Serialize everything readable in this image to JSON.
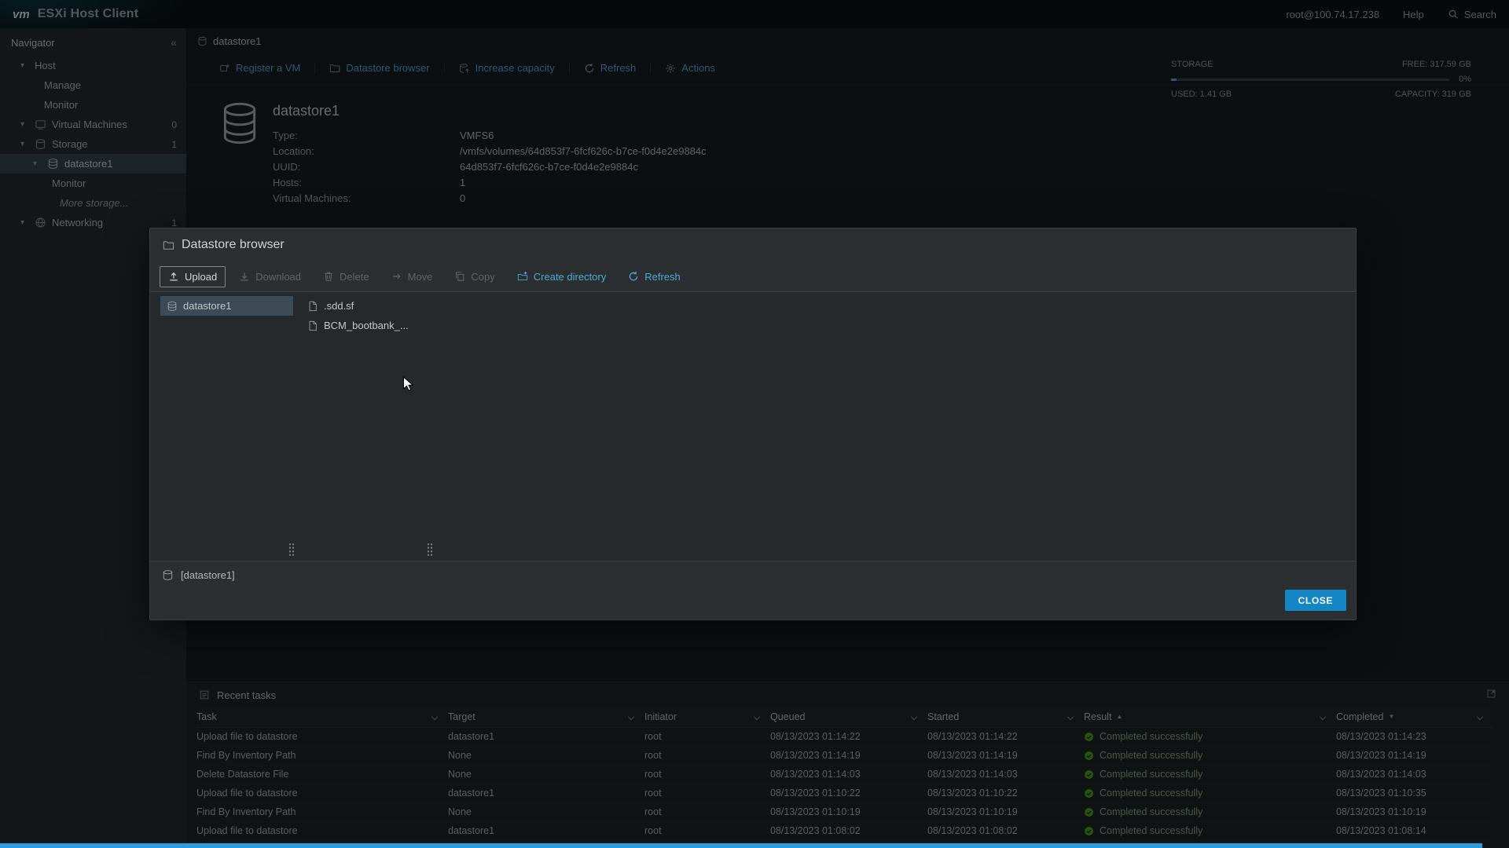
{
  "colors": {
    "accent": "#4fa8d5",
    "primary-button": "#1486c5",
    "success": "#52a114",
    "selection": "#3c4b55",
    "sidebar-selection": "#36444d"
  },
  "header": {
    "logo": "vm",
    "title": "ESXi Host Client",
    "user": "root@100.74.17.238",
    "help": "Help",
    "search": "Search"
  },
  "sidebar": {
    "title": "Navigator",
    "items": [
      {
        "label": "Host",
        "level": 0,
        "caret": true
      },
      {
        "label": "Manage",
        "level": 1,
        "plain": true
      },
      {
        "label": "Monitor",
        "level": 1,
        "plain": true
      },
      {
        "label": "Virtual Machines",
        "level": 0,
        "caret": true,
        "icon": "vm",
        "badge": "0"
      },
      {
        "label": "Storage",
        "level": 0,
        "caret": true,
        "icon": "storage",
        "badge": "1"
      },
      {
        "label": "datastore1",
        "level": 1,
        "caret": true,
        "icon": "datastore",
        "selected": true
      },
      {
        "label": "Monitor",
        "level": 2,
        "plain": true
      },
      {
        "label": "More storage...",
        "level": 3,
        "plain": true,
        "italic": true
      },
      {
        "label": "Networking",
        "level": 0,
        "caret": true,
        "icon": "network",
        "badge": "1"
      }
    ]
  },
  "main": {
    "tab": "datastore1",
    "toolbar": [
      {
        "label": "Register a VM",
        "icon": "register"
      },
      {
        "label": "Datastore browser",
        "icon": "browser"
      },
      {
        "label": "Increase capacity",
        "icon": "capacity"
      },
      {
        "label": "Refresh",
        "icon": "refresh"
      },
      {
        "label": "Actions",
        "icon": "gear"
      }
    ],
    "storage": {
      "label": "STORAGE",
      "free": "FREE: 317.59 GB",
      "percent": "0%",
      "used": "USED: 1.41 GB",
      "capacity": "CAPACITY: 319 GB"
    },
    "datastore_name": "datastore1",
    "info_rows": [
      {
        "label": "Type:",
        "value": "VMFS6"
      },
      {
        "label": "Location:",
        "value": "/vmfs/volumes/64d853f7-6fcf626c-b7ce-f0d4e2e9884c"
      },
      {
        "label": "UUID:",
        "value": "64d853f7-6fcf626c-b7ce-f0d4e2e9884c"
      },
      {
        "label": "Hosts:",
        "value": "1"
      },
      {
        "label": "Virtual Machines:",
        "value": "0"
      }
    ]
  },
  "modal": {
    "title": "Datastore browser",
    "toolbar": [
      {
        "label": "Upload",
        "icon": "upload",
        "state": "active"
      },
      {
        "label": "Download",
        "icon": "download",
        "state": "disabled"
      },
      {
        "label": "Delete",
        "icon": "delete",
        "state": "disabled"
      },
      {
        "label": "Move",
        "icon": "move",
        "state": "disabled"
      },
      {
        "label": "Copy",
        "icon": "copy",
        "state": "disabled"
      },
      {
        "label": "Create directory",
        "icon": "folder-plus",
        "state": "enabled"
      },
      {
        "label": "Refresh",
        "icon": "refresh",
        "state": "enabled"
      }
    ],
    "folders": [
      {
        "label": "datastore1",
        "selected": true
      }
    ],
    "files": [
      {
        "label": ".sdd.sf"
      },
      {
        "label": "BCM_bootbank_..."
      }
    ],
    "status": "[datastore1]",
    "close_label": "CLOSE"
  },
  "tasks": {
    "title": "Recent tasks",
    "columns": [
      {
        "label": "Task",
        "sort": ""
      },
      {
        "label": "Target",
        "sort": ""
      },
      {
        "label": "Initiator",
        "sort": ""
      },
      {
        "label": "Queued",
        "sort": ""
      },
      {
        "label": "Started",
        "sort": ""
      },
      {
        "label": "Result",
        "sort": "asc"
      },
      {
        "label": "Completed",
        "sort": "desc"
      }
    ],
    "rows": [
      {
        "task": "Upload file to datastore",
        "target": "datastore1",
        "initiator": "root",
        "queued": "08/13/2023 01:14:22",
        "started": "08/13/2023 01:14:22",
        "result": "Completed successfully",
        "completed": "08/13/2023 01:14:23"
      },
      {
        "task": "Find By Inventory Path",
        "target": "None",
        "initiator": "root",
        "queued": "08/13/2023 01:14:19",
        "started": "08/13/2023 01:14:19",
        "result": "Completed successfully",
        "completed": "08/13/2023 01:14:19"
      },
      {
        "task": "Delete Datastore File",
        "target": "None",
        "initiator": "root",
        "queued": "08/13/2023 01:14:03",
        "started": "08/13/2023 01:14:03",
        "result": "Completed successfully",
        "completed": "08/13/2023 01:14:03"
      },
      {
        "task": "Upload file to datastore",
        "target": "datastore1",
        "initiator": "root",
        "queued": "08/13/2023 01:10:22",
        "started": "08/13/2023 01:10:22",
        "result": "Completed successfully",
        "completed": "08/13/2023 01:10:35"
      },
      {
        "task": "Find By Inventory Path",
        "target": "None",
        "initiator": "root",
        "queued": "08/13/2023 01:10:19",
        "started": "08/13/2023 01:10:19",
        "result": "Completed successfully",
        "completed": "08/13/2023 01:10:19"
      },
      {
        "task": "Upload file to datastore",
        "target": "datastore1",
        "initiator": "root",
        "queued": "08/13/2023 01:08:02",
        "started": "08/13/2023 01:08:02",
        "result": "Completed successfully",
        "completed": "08/13/2023 01:08:14"
      }
    ]
  }
}
